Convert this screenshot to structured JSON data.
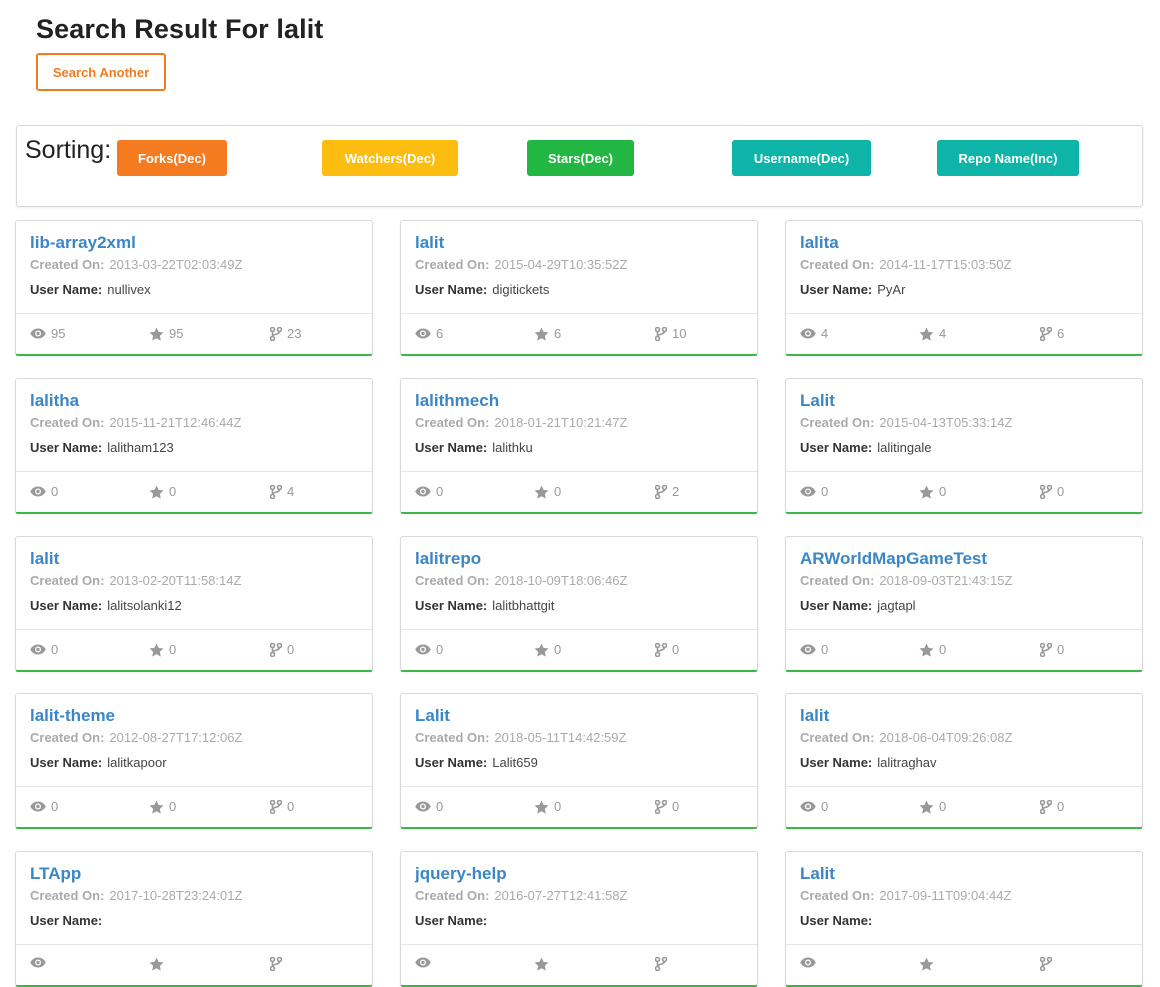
{
  "header": {
    "title": "Search Result For lalit",
    "search_another_label": "Search Another"
  },
  "sorting": {
    "label": "Sorting:",
    "buttons": [
      {
        "label": "Forks(Dec)",
        "color": "#f47b20"
      },
      {
        "label": "Watchers(Dec)",
        "color": "#fcbd10"
      },
      {
        "label": "Stars(Dec)",
        "color": "#22b742"
      },
      {
        "label": "Username(Dec)",
        "color": "#0db4a7"
      },
      {
        "label": "Repo Name(Inc)",
        "color": "#0db4a7"
      }
    ]
  },
  "labels": {
    "created_on": "Created On:",
    "user_name": "User Name:"
  },
  "icons": {
    "watchers": "eye-icon",
    "stars": "star-icon",
    "forks": "fork-icon"
  },
  "repos": [
    {
      "name": "lib-array2xml",
      "created": "2013-03-22T02:03:49Z",
      "user": "nullivex",
      "watchers": "95",
      "stars": "95",
      "forks": "23"
    },
    {
      "name": "lalit",
      "created": "2015-04-29T10:35:52Z",
      "user": "digitickets",
      "watchers": "6",
      "stars": "6",
      "forks": "10"
    },
    {
      "name": "lalita",
      "created": "2014-11-17T15:03:50Z",
      "user": "PyAr",
      "watchers": "4",
      "stars": "4",
      "forks": "6"
    },
    {
      "name": "lalitha",
      "created": "2015-11-21T12:46:44Z",
      "user": "lalitham123",
      "watchers": "0",
      "stars": "0",
      "forks": "4"
    },
    {
      "name": "lalithmech",
      "created": "2018-01-21T10:21:47Z",
      "user": "lalithku",
      "watchers": "0",
      "stars": "0",
      "forks": "2"
    },
    {
      "name": "Lalit",
      "created": "2015-04-13T05:33:14Z",
      "user": "lalitingale",
      "watchers": "0",
      "stars": "0",
      "forks": "0"
    },
    {
      "name": "lalit",
      "created": "2013-02-20T11:58:14Z",
      "user": "lalitsolanki12",
      "watchers": "0",
      "stars": "0",
      "forks": "0"
    },
    {
      "name": "lalitrepo",
      "created": "2018-10-09T18:06:46Z",
      "user": "lalitbhattgit",
      "watchers": "0",
      "stars": "0",
      "forks": "0"
    },
    {
      "name": "ARWorldMapGameTest",
      "created": "2018-09-03T21:43:15Z",
      "user": "jagtapl",
      "watchers": "0",
      "stars": "0",
      "forks": "0"
    },
    {
      "name": "lalit-theme",
      "created": "2012-08-27T17:12:06Z",
      "user": "lalitkapoor",
      "watchers": "0",
      "stars": "0",
      "forks": "0"
    },
    {
      "name": "Lalit",
      "created": "2018-05-11T14:42:59Z",
      "user": "Lalit659",
      "watchers": "0",
      "stars": "0",
      "forks": "0"
    },
    {
      "name": "lalit",
      "created": "2018-06-04T09:26:08Z",
      "user": "lalitraghav",
      "watchers": "0",
      "stars": "0",
      "forks": "0"
    },
    {
      "name": "LTApp",
      "created": "2017-10-28T23:24:01Z",
      "user": "",
      "watchers": "",
      "stars": "",
      "forks": ""
    },
    {
      "name": "jquery-help",
      "created": "2016-07-27T12:41:58Z",
      "user": "",
      "watchers": "",
      "stars": "",
      "forks": ""
    },
    {
      "name": "Lalit",
      "created": "2017-09-11T09:04:44Z",
      "user": "",
      "watchers": "",
      "stars": "",
      "forks": ""
    }
  ]
}
